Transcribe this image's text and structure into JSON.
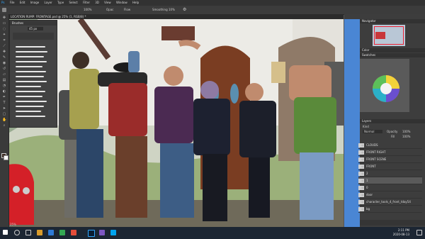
{
  "menu": [
    "Ps",
    "File",
    "Edit",
    "Image",
    "Layer",
    "Type",
    "Select",
    "Filter",
    "3D",
    "View",
    "Window",
    "Help"
  ],
  "options": {
    "zoom_label": "100%",
    "smoothing": "Smoothing",
    "smooth_value": "10%",
    "flow": "Flow",
    "opacity": "Opac"
  },
  "document_tab": "LOCATION RUMP: FRONTAGE.psd @ 25% (1, RGB/8) *",
  "brush_panel": {
    "title": "Brushes",
    "size_value": "45 px"
  },
  "right": {
    "navigator_title": "Navigator",
    "color_title": "Color",
    "swatches_title": "Swatches",
    "layers_title": "Layers",
    "layer_kind": "Kind",
    "blend_mode": "Normal",
    "opacity_label": "Opacity",
    "opacity_value": "100%",
    "fill_label": "Fill",
    "fill_value": "100%",
    "layers": [
      {
        "name": "CLOUDS"
      },
      {
        "name": "FRONT RIGHT"
      },
      {
        "name": "FRONT SCENE"
      },
      {
        "name": "FRONT"
      },
      {
        "name": "2"
      },
      {
        "name": "1"
      },
      {
        "name": "0"
      },
      {
        "name": "door"
      },
      {
        "name": "character_tools_4_front_tday54"
      },
      {
        "name": "bg"
      }
    ]
  },
  "status": {
    "zoom": "25%"
  },
  "taskbar": {
    "time": "2:11 PM",
    "date": "2020-08-13"
  },
  "colors": {
    "accent_blue": "#2d6fb8",
    "sky_strip": "#4a86d4"
  }
}
